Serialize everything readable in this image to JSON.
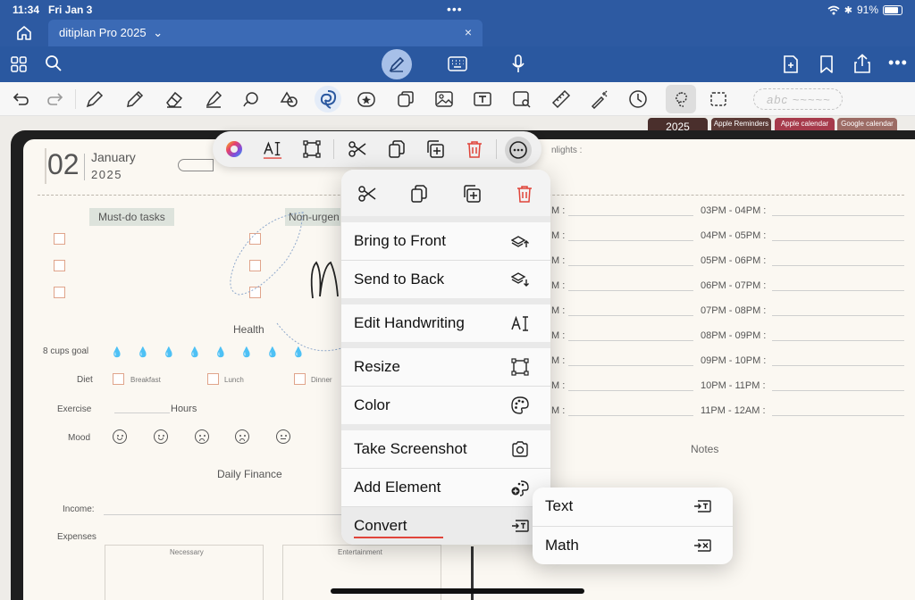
{
  "status": {
    "time": "11:34",
    "date": "Fri Jan 3",
    "battery": "91%"
  },
  "tab": {
    "title": "ditiplan Pro 2025",
    "chevron": "⌄",
    "close": "×"
  },
  "year_tabs": [
    {
      "label": "2025",
      "color": "#4a2f2c"
    },
    {
      "label": "Apple Reminders",
      "color": "#5b3a36"
    },
    {
      "label": "Apple calendar",
      "color": "#a63a4b"
    },
    {
      "label": "Google calendar",
      "color": "#9c6b64"
    }
  ],
  "stylus_placeholder": "abc ~~~~~",
  "planner": {
    "day": "02",
    "month": "January",
    "year": "2025",
    "highlights_label": "nlights :",
    "must_do": "Must-do tasks",
    "non_urgent": "Non-urgen",
    "health": "Health",
    "cups_goal": "8 cups goal",
    "diet": "Diet",
    "breakfast": "Breakfast",
    "lunch": "Lunch",
    "dinner": "Dinner",
    "exercise": "Exercise",
    "hours": "Hours",
    "mood": "Mood",
    "daily_finance": "Daily Finance",
    "income": "Income:",
    "expenses": "Expenses",
    "necessary": "Necessary",
    "entertainment": "Entertainment",
    "notes": "Notes",
    "time_colon": "M :",
    "schedule": [
      "03PM - 04PM :",
      "04PM - 05PM :",
      "05PM - 06PM :",
      "06PM - 07PM :",
      "07PM - 08PM :",
      "08PM - 09PM :",
      "09PM - 10PM :",
      "10PM - 11PM :",
      "11PM - 12AM :"
    ]
  },
  "menu": {
    "bring_front": "Bring to Front",
    "send_back": "Send to Back",
    "edit_handwriting": "Edit Handwriting",
    "resize": "Resize",
    "color": "Color",
    "screenshot": "Take Screenshot",
    "add_element": "Add Element",
    "convert": "Convert"
  },
  "submenu": {
    "text": "Text",
    "math": "Math"
  },
  "colors": {
    "accent_blue": "#2a58a0",
    "delete_red": "#e0443a",
    "paper": "#fbf8f2"
  }
}
